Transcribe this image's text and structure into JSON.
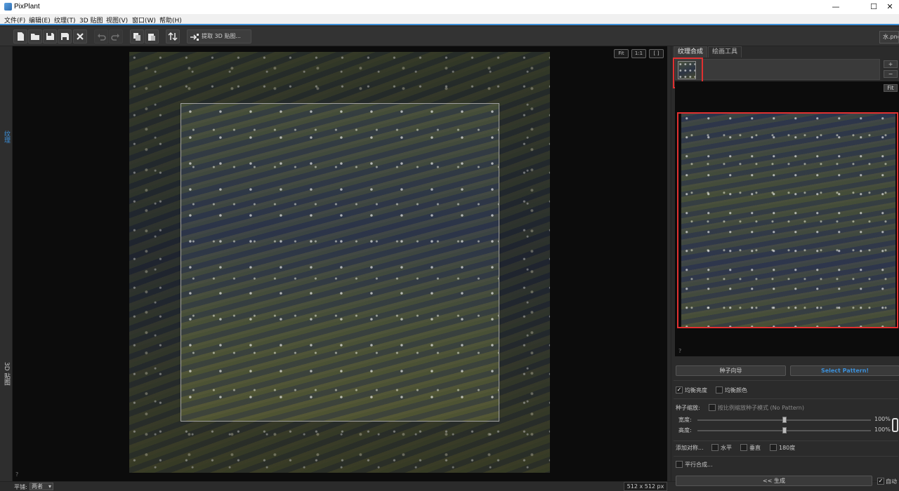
{
  "window": {
    "title": "PixPlant",
    "controls": [
      "—",
      "☐",
      "✕"
    ]
  },
  "menu": [
    "文件(F)",
    "编辑(E)",
    "纹理(T)",
    "3D 贴图",
    "视图(V)",
    "窗口(W)",
    "帮助(H)"
  ],
  "toolbar": {
    "extract_label": "提取 3D 贴图..."
  },
  "file_tab": {
    "label": "水.png"
  },
  "left_tabs": {
    "texture": "纹理",
    "map3d": "3D 贴图"
  },
  "canvas": {
    "view_buttons": [
      "Fit",
      "1:1",
      "[ ]"
    ],
    "help": "?"
  },
  "status": {
    "pan_label": "平铺:",
    "pan_value": "两者",
    "size": "512 x 512 px"
  },
  "right_panel": {
    "tabs": [
      "纹理合成",
      "绘画工具"
    ],
    "plus": "+",
    "minus": "−",
    "fit": "Fit",
    "help": "?",
    "seed_wizard": "种子向导",
    "select_pattern": "Select Pattern!",
    "balance_brightness": "均衡亮度",
    "balance_color": "均衡颜色",
    "seed_scale": "种子缩放:",
    "scale_mode": "按比例缩放种子模式 (No Pattern)",
    "width_label": "宽度:",
    "width_value": "100%",
    "height_label": "高度:",
    "height_value": "100%",
    "add_symmetry": "添加对称...",
    "horizontal": "水平",
    "vertical": "垂直",
    "deg180": "180度",
    "parallel": "平行合成...",
    "generate": "<< 生成",
    "auto": "自动",
    "check": "✓"
  },
  "colors": {
    "accent": "#3c8fd8",
    "highlight": "#e03030"
  }
}
